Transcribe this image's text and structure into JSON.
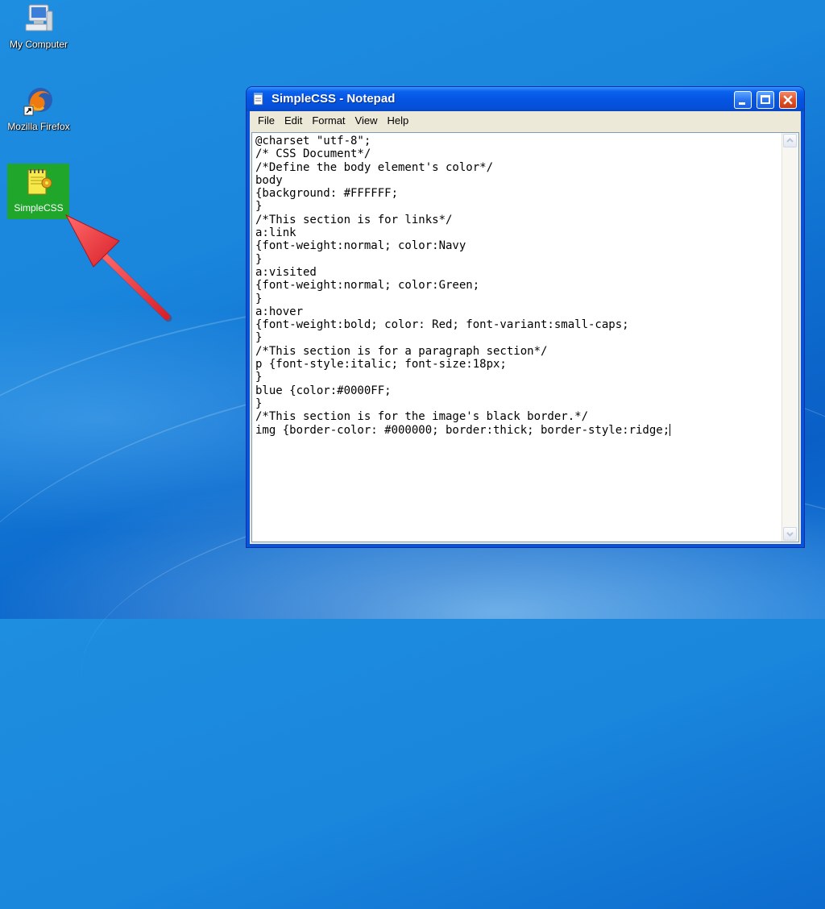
{
  "desktop": {
    "icons": [
      {
        "label": "My Computer",
        "icon": "my-computer-icon"
      },
      {
        "label": "Mozilla Firefox",
        "icon": "firefox-icon"
      },
      {
        "label": "SimpleCSS",
        "icon": "text-document-icon",
        "selected": true
      }
    ],
    "annotation": "red-arrow-pointer"
  },
  "window": {
    "title": "SimpleCSS - Notepad",
    "app_icon": "notepad-icon",
    "controls": [
      "minimize",
      "maximize",
      "close"
    ],
    "menu": [
      "File",
      "Edit",
      "Format",
      "View",
      "Help"
    ],
    "content_lines": [
      "@charset \"utf-8\";",
      "/* CSS Document*/",
      "/*Define the body element's color*/",
      "body",
      "{background: #FFFFFF;",
      "}",
      "/*This section is for links*/",
      "a:link",
      "{font-weight:normal; color:Navy",
      "}",
      "a:visited",
      "{font-weight:normal; color:Green;",
      "}",
      "a:hover",
      "{font-weight:bold; color: Red; font-variant:small-caps;",
      "}",
      "/*This section is for a paragraph section*/",
      "p {font-style:italic; font-size:18px;",
      "}",
      "blue {color:#0000FF;",
      "}",
      "/*This section is for the image's black border.*/",
      "img {border-color: #000000; border:thick; border-style:ridge;"
    ]
  },
  "colors": {
    "desktop_blue": "#1a86dc",
    "titlebar_blue": "#0554e3",
    "selection_green": "#21a62c",
    "arrow_red": "#e8323c"
  }
}
